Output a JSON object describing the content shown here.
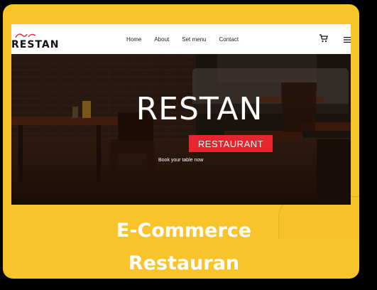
{
  "site": {
    "logo_text": "RESTAN",
    "nav": [
      "Home",
      "About",
      "Set menu",
      "Contact"
    ]
  },
  "hero": {
    "title": "RESTAN",
    "badge": "RESTAURANT",
    "subtitle": "Book your table now"
  },
  "caption": {
    "line1": "E-Commerce",
    "line2": "Restauran"
  },
  "colors": {
    "card_yellow": "#f9c32c",
    "badge_red": "#e5262f",
    "background": "#000000"
  },
  "icons": {
    "cart": "cart-icon",
    "menu": "hamburger-menu-icon",
    "logo_mark": "chef-hat-icon"
  }
}
